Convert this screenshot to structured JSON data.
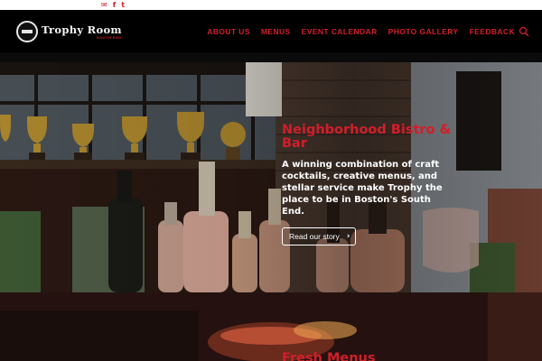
{
  "social": {
    "icons": [
      "email-icon",
      "facebook-icon",
      "twitter-icon"
    ],
    "glyphs": [
      "✉",
      "f",
      "t"
    ]
  },
  "brand": {
    "name": "Trophy Room",
    "tagline": "SOUTH END",
    "accent": "#d21e2b"
  },
  "nav": {
    "items": [
      "ABOUT US",
      "MENUS",
      "EVENT CALENDAR",
      "PHOTO GALLERY",
      "FEEDBACK"
    ],
    "search_icon": "search-icon"
  },
  "hero": {
    "title": "Neighborhood Bistro & Bar",
    "text": "A winning combination of craft cocktails, creative menus, and stellar service make Trophy the place to be in Boston's South End.",
    "button_label": "Read our story",
    "button_icon": "chevron-right-icon"
  },
  "next_section": {
    "title": "Fresh Menus"
  }
}
